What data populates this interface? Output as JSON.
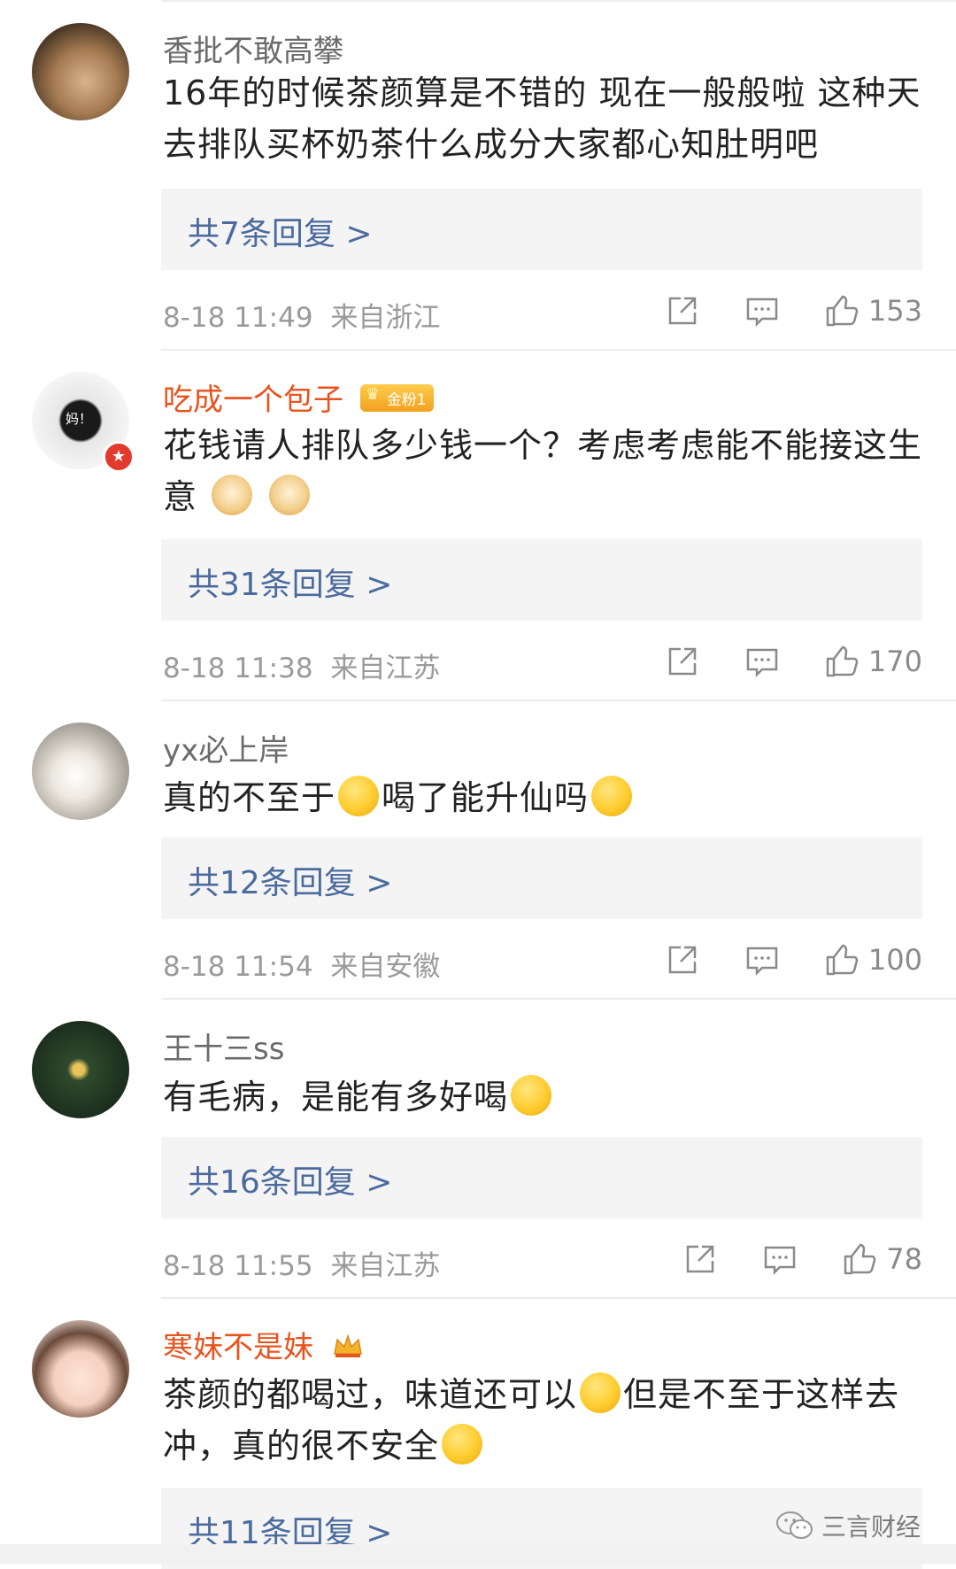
{
  "comments": [
    {
      "username": "香批不敢高攀",
      "vip": false,
      "text": "16年的时候茶颜算是不错的 现在一般般啦 这种天去排队买杯奶茶什么成分大家都心知肚明吧",
      "replies": "共7条回复 >",
      "time": "8-18 11:49",
      "location": "来自浙江",
      "likes": "153"
    },
    {
      "username": "吃成一个包子",
      "vip": true,
      "badge": "金粉1",
      "avatar_text": "妈！",
      "text": "花钱请人排队多少钱一个？考虑考虑能不能接这生意",
      "replies": "共31条回复 >",
      "time": "8-18 11:38",
      "location": "来自江苏",
      "likes": "170"
    },
    {
      "username": "yx必上岸",
      "vip": false,
      "text_a": "真的不至于",
      "text_b": "喝了能升仙吗",
      "replies": "共12条回复 >",
      "time": "8-18 11:54",
      "location": "来自安徽",
      "likes": "100"
    },
    {
      "username": "王十三ss",
      "vip": false,
      "text": "有毛病，是能有多好喝",
      "replies": "共16条回复 >",
      "time": "8-18 11:55",
      "location": "来自江苏",
      "likes": "78"
    },
    {
      "username": "寒妹不是妹",
      "vip": true,
      "text_a": "茶颜的都喝过，味道还可以",
      "text_b": "但是不至于这样去冲，真的很不安全",
      "replies": "共11条回复 >"
    }
  ],
  "watermark": "三言财经",
  "colors": {
    "vip_name": "#e8541e",
    "link": "#4b6b9e",
    "meta": "#9a9a9a"
  }
}
